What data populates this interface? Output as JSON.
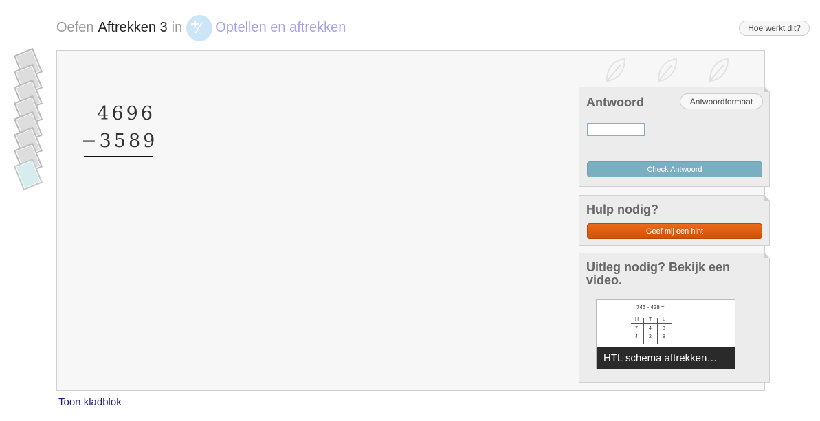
{
  "header": {
    "prefix": "Oefen",
    "exercise": "Aftrekken 3",
    "connector": "in",
    "topic_icon": "plus-minus-icon",
    "topic": "Optellen en aftrekken",
    "help_button": "Hoe werkt dit?"
  },
  "stack": {
    "card_count": 8,
    "current_index": 7
  },
  "problem": {
    "top": "4696",
    "operator": "−",
    "bottom": "3589"
  },
  "streak_icons": [
    "leaf-icon",
    "leaf-icon",
    "leaf-icon"
  ],
  "answer_panel": {
    "title": "Antwoord",
    "format_button": "Antwoordformaat",
    "input_value": "",
    "check_button": "Check Antwoord"
  },
  "hint_panel": {
    "title": "Hulp nodig?",
    "hint_button": "Geef mij een hint"
  },
  "video_panel": {
    "title": "Uitleg nodig? Bekijk een video.",
    "thumb_equation": "743 - 428 =",
    "thumb_headers": [
      "H",
      "T",
      "L"
    ],
    "thumb_row1": [
      "7",
      "4",
      "3"
    ],
    "thumb_row2": [
      "4",
      "2",
      "8"
    ],
    "video_caption": "HTL schema aftrekken…"
  },
  "scratchpad_link": "Toon kladblok",
  "colors": {
    "topic": "#a6a3e8",
    "check_button": "#7aafc2",
    "hint_button": "#e2600f",
    "link": "#1a1e7a"
  }
}
